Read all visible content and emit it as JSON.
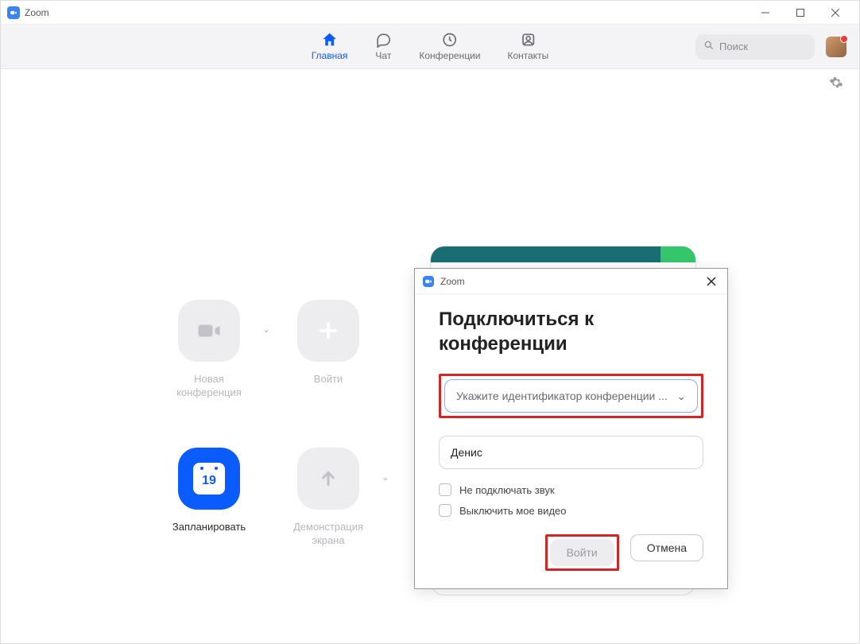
{
  "title": "Zoom",
  "nav": {
    "home": "Главная",
    "chat": "Чат",
    "meetings": "Конференции",
    "contacts": "Контакты"
  },
  "search": {
    "placeholder": "Поиск"
  },
  "tiles": {
    "new_meeting": "Новая конференция",
    "join": "Войти",
    "schedule": "Запланировать",
    "share_screen": "Демонстрация экрана",
    "date_num": "19"
  },
  "dialog": {
    "app_title": "Zoom",
    "heading": "Подключиться к конференции",
    "meeting_id_placeholder": "Укажите идентификатор конференции ...",
    "name_value": "Денис",
    "opt_no_audio": "Не подключать звук",
    "opt_no_video": "Выключить мое видео",
    "join_btn": "Войти",
    "cancel_btn": "Отмена"
  }
}
